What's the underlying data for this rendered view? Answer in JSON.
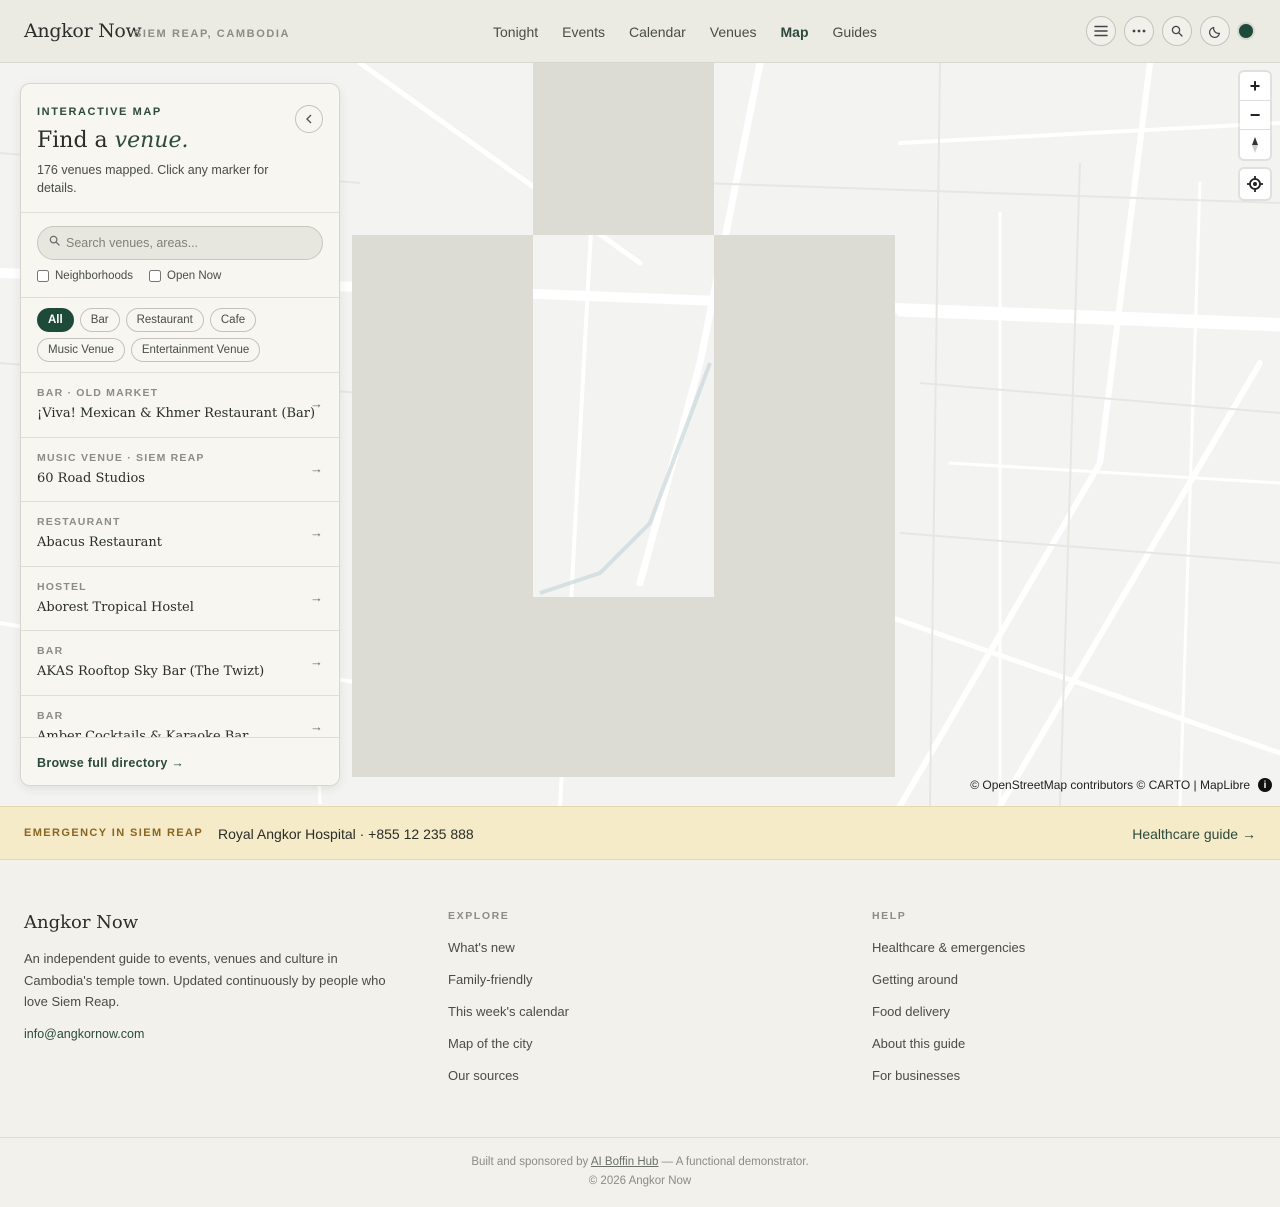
{
  "header": {
    "brand": "Angkor Now",
    "location": "SIEM REAP, CAMBODIA",
    "nav": [
      "Tonight",
      "Events",
      "Calendar",
      "Venues",
      "Map",
      "Guides"
    ],
    "active_nav": "Map",
    "icons": [
      "menu-icon",
      "more-icon",
      "search-icon",
      "moon-icon",
      "theme-dot"
    ],
    "accent_color": "#1e4a3a"
  },
  "panel": {
    "kicker": "INTERACTIVE MAP",
    "title_prefix": "Find a",
    "title_em": "venue.",
    "description": "176 venues mapped. Click any marker for details.",
    "search_placeholder": "Search venues, areas...",
    "checkboxes": [
      "Neighborhoods",
      "Open Now"
    ],
    "filters": [
      "All",
      "Bar",
      "Restaurant",
      "Cafe",
      "Music Venue",
      "Entertainment Venue"
    ],
    "active_filter": "All",
    "venues": [
      {
        "category": "BAR · OLD MARKET",
        "name": "¡Viva! Mexican & Khmer Restaurant (Bar)"
      },
      {
        "category": "MUSIC VENUE · SIEM REAP",
        "name": "60 Road Studios"
      },
      {
        "category": "RESTAURANT",
        "name": "Abacus Restaurant"
      },
      {
        "category": "HOSTEL",
        "name": "Aborest Tropical Hostel"
      },
      {
        "category": "BAR",
        "name": "AKAS Rooftop Sky Bar (The Twizt)"
      },
      {
        "category": "BAR",
        "name": "Amber Cocktails & Karaoke Bar"
      }
    ],
    "browse_link": "Browse full directory →"
  },
  "map": {
    "attribution": "© OpenStreetMap contributors © CARTO | MapLibre",
    "zoom_in": "+",
    "zoom_out": "−"
  },
  "emergency": {
    "label": "EMERGENCY IN SIEM REAP",
    "value": "Royal Angkor Hospital · +855 12 235 888",
    "link": "Healthcare guide →",
    "background": "#f5ebc8"
  },
  "footer": {
    "brand": "Angkor Now",
    "description": "An independent guide to events, venues and culture in Cambodia's temple town. Updated continuously by people who love Siem Reap.",
    "email": "info@angkornow.com",
    "explore_heading": "EXPLORE",
    "explore_links": [
      "What's new",
      "Family-friendly",
      "This week's calendar",
      "Map of the city",
      "Our sources"
    ],
    "help_heading": "HELP",
    "help_links": [
      "Healthcare & emergencies",
      "Getting around",
      "Food delivery",
      "About this guide",
      "For businesses"
    ],
    "built_prefix": "Built and sponsored by",
    "built_link": "AI Boffin Hub",
    "built_suffix": "— A functional demonstrator.",
    "copyright": "© 2026 Angkor Now"
  }
}
